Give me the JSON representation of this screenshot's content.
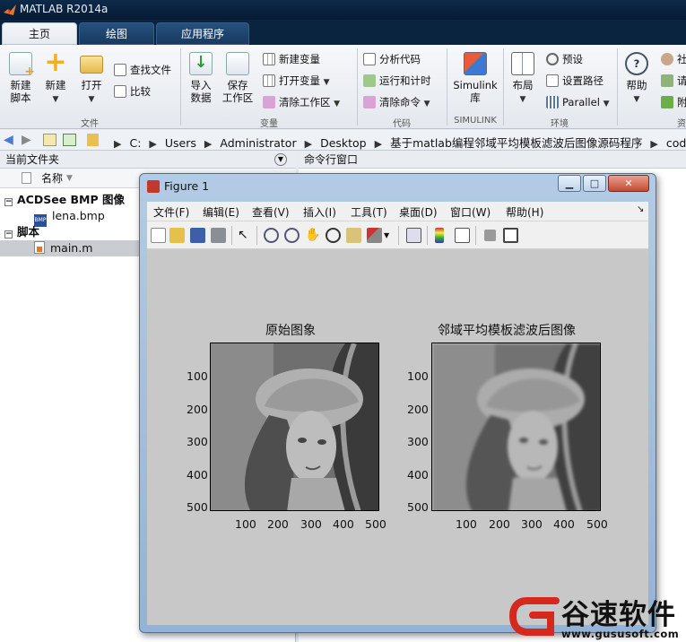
{
  "app": {
    "title": "MATLAB R2014a"
  },
  "tabs": [
    {
      "label": "主页"
    },
    {
      "label": "绘图"
    },
    {
      "label": "应用程序"
    }
  ],
  "ribbon": {
    "file": {
      "new_script": "新建\n脚本",
      "new": "新建",
      "open": "打开",
      "find_files": "查找文件",
      "compare": "比较",
      "group": "文件"
    },
    "variable": {
      "import": "导入\n数据",
      "save_ws": "保存\n工作区",
      "new_var": "新建变量",
      "open_var": "打开变量",
      "clear_ws": "清除工作区",
      "group": "变量"
    },
    "code": {
      "analyze": "分析代码",
      "run_time": "运行和计时",
      "clear_cmd": "清除命令",
      "group": "代码"
    },
    "simulink": {
      "lib": "Simulink\n库",
      "group": "SIMULINK"
    },
    "env": {
      "layout": "布局",
      "prefs": "预设",
      "set_path": "设置路径",
      "parallel": "Parallel",
      "group": "环境"
    },
    "resources": {
      "help": "帮助",
      "c1": "社",
      "c2": "请",
      "c3": "附",
      "group": "资源"
    }
  },
  "address": {
    "parts": [
      "C:",
      "Users",
      "Administrator",
      "Desktop",
      "基于matlab编程邻域平均模板滤波后图像源码程序",
      "code"
    ]
  },
  "file_panel": {
    "title": "当前文件夹",
    "col_name": "名称",
    "groups": [
      {
        "label": "ACDSee BMP 图像",
        "files": [
          "lena.bmp"
        ]
      },
      {
        "label": "脚本",
        "files": [
          "main.m"
        ]
      }
    ]
  },
  "command_window": {
    "title": "命令行窗口"
  },
  "figure": {
    "title": "Figure 1",
    "menu": [
      "文件(F)",
      "编辑(E)",
      "查看(V)",
      "插入(I)",
      "工具(T)",
      "桌面(D)",
      "窗口(W)",
      "帮助(H)"
    ],
    "axes": [
      {
        "title": "原始图象",
        "yticks": [
          "100",
          "200",
          "300",
          "400",
          "500"
        ],
        "xticks": [
          "100",
          "200",
          "300",
          "400",
          "500"
        ]
      },
      {
        "title": "邻域平均模板滤波后图像",
        "yticks": [
          "100",
          "200",
          "300",
          "400",
          "500"
        ],
        "xticks": [
          "100",
          "200",
          "300",
          "400",
          "500"
        ]
      }
    ]
  },
  "watermark": {
    "brand": "谷速软件",
    "url": "www.gususoft.com"
  },
  "colors": {
    "titlebar": "#0d2a4a",
    "ribbon_bg": "#eef1f5",
    "figure_bg": "#c8c8c8",
    "watermark_red": "#d6281c"
  }
}
